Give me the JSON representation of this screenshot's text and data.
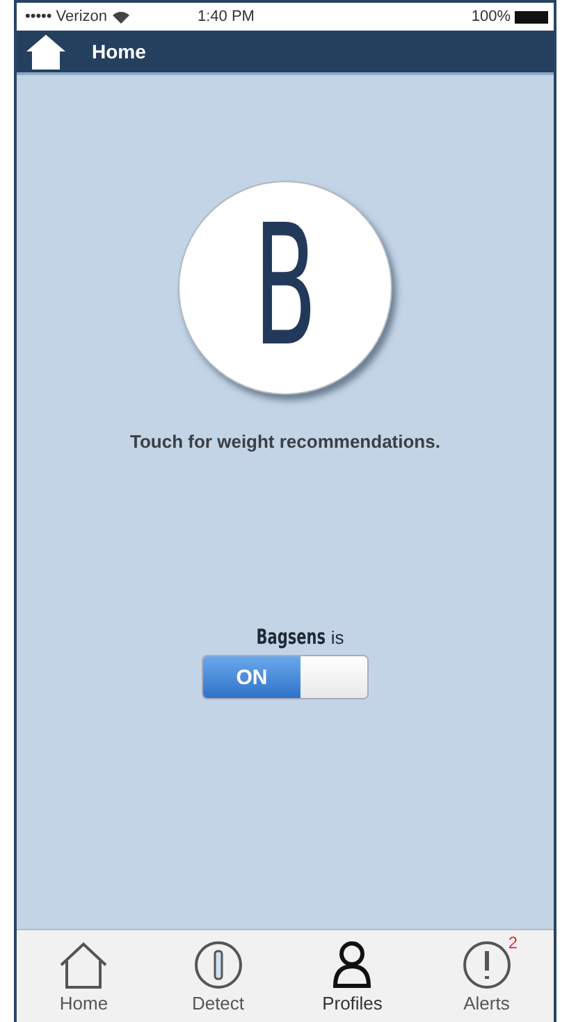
{
  "status_bar": {
    "carrier": "••••• Verizon",
    "time": "1:40 PM",
    "battery": "100%"
  },
  "nav_bar": {
    "title": "Home"
  },
  "logo": {
    "letter": "B"
  },
  "hint": "Touch for weight recommendations.",
  "toggle": {
    "label": "Bagsens",
    "suffix": "is",
    "on_label": "ON",
    "on": true
  },
  "tabs": [
    {
      "label": "Home",
      "kind": "home",
      "selected": false
    },
    {
      "label": "Detect",
      "kind": "detect",
      "selected": false
    },
    {
      "label": "Profiles",
      "kind": "profile",
      "selected": true
    },
    {
      "label": "Alerts",
      "kind": "alert",
      "selected": false,
      "badge": "2"
    }
  ]
}
